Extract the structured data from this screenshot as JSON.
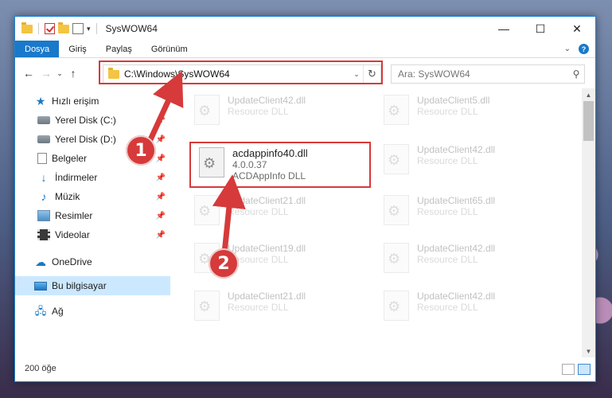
{
  "window": {
    "title": "SysWOW64",
    "controls": {
      "minimize": "—",
      "maximize": "☐",
      "close": "✕"
    }
  },
  "ribbon": {
    "tabs": [
      "Dosya",
      "Giriş",
      "Paylaş",
      "Görünüm"
    ],
    "active_tab": "Dosya",
    "expand_glyph": "⌄",
    "help_glyph": "?"
  },
  "navigation": {
    "back": "←",
    "forward": "→",
    "recent": "⌄",
    "up": "↑",
    "address": "C:\\Windows\\SysWOW64",
    "address_dropdown": "⌄",
    "refresh": "↻",
    "search_placeholder": "Ara: SysWOW64"
  },
  "nav_pane": {
    "quick_access": "Hızlı erişim",
    "quick_items": [
      {
        "label": "Yerel Disk (C:)",
        "icon": "disk-icon"
      },
      {
        "label": "Yerel Disk (D:)",
        "icon": "disk-icon"
      },
      {
        "label": "Belgeler",
        "icon": "documents-icon"
      },
      {
        "label": "İndirmeler",
        "icon": "downloads-icon"
      },
      {
        "label": "Müzik",
        "icon": "music-icon"
      },
      {
        "label": "Resimler",
        "icon": "pictures-icon"
      },
      {
        "label": "Videolar",
        "icon": "videos-icon"
      }
    ],
    "onedrive": "OneDrive",
    "this_pc": "Bu bilgisayar",
    "network": "Ağ"
  },
  "files": {
    "highlighted": {
      "name": "acdappinfo40.dll",
      "version": "4.0.0.37",
      "description": "ACDAppInfo DLL"
    },
    "background": [
      {
        "name": "UpdateClient42.dll",
        "description": "Resource DLL"
      },
      {
        "name": "UpdateClient5.dll",
        "description": "Resource DLL"
      },
      {
        "name": "UpdateClient42.dll",
        "description": "Resource DLL"
      },
      {
        "name": "UpdateClient21.dll",
        "description": "Resource DLL"
      },
      {
        "name": "UpdateClient65.dll",
        "description": "Resource DLL"
      },
      {
        "name": "UpdateClient19.dll",
        "description": "Resource DLL"
      },
      {
        "name": "UpdateClient42.dll",
        "description": "Resource DLL"
      },
      {
        "name": "UpdateClient21.dll",
        "description": "Resource DLL"
      },
      {
        "name": "UpdateClient42.dll",
        "description": "Resource DLL"
      }
    ]
  },
  "status": {
    "item_count": "200 öğe"
  },
  "callouts": [
    "1",
    "2"
  ],
  "colors": {
    "accent": "#1979ca",
    "annotation_red": "#d63a3a",
    "selection": "#cce8ff"
  }
}
